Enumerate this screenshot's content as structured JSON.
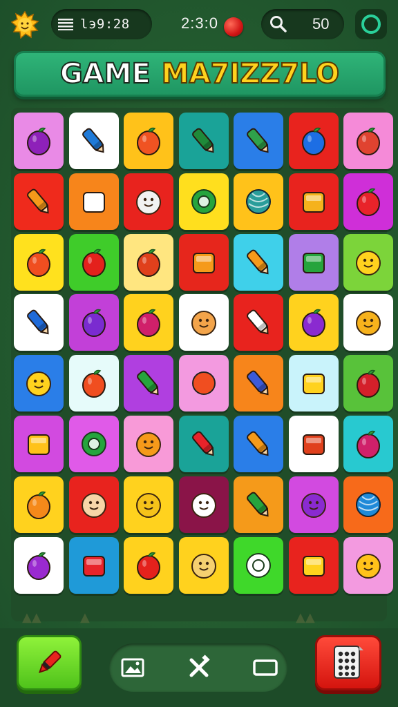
{
  "top_bar": {
    "menu_label": "lэ9:28",
    "timer": "2:3:0",
    "score": "50"
  },
  "banner": {
    "title_white": "GAME",
    "title_yellow": "MA7IZZ7LO"
  },
  "tiles": [
    {
      "bg": "#e98ae6",
      "icon": "plum-icon",
      "fg": "#8e21b9"
    },
    {
      "bg": "#ffffff",
      "icon": "bird-icon",
      "fg": "#1f7ad8"
    },
    {
      "bg": "#ffc21a",
      "icon": "tomato-icon",
      "fg": "#f05322"
    },
    {
      "bg": "#1aa398",
      "icon": "marker-icon",
      "fg": "#1f8a3a"
    },
    {
      "bg": "#2a7ee8",
      "icon": "phone-icon",
      "fg": "#2fa14a"
    },
    {
      "bg": "#e8231e",
      "icon": "blueberry-icon",
      "fg": "#1d6ee4"
    },
    {
      "bg": "#f58ad8",
      "icon": "strawberry-icon",
      "fg": "#e04330"
    },
    {
      "bg": "#ef2a1c",
      "icon": "hand-icon",
      "fg": "#f59a1a"
    },
    {
      "bg": "#f7851b",
      "icon": "cup-icon",
      "fg": "#ffffff"
    },
    {
      "bg": "#e8231e",
      "icon": "cat-face-icon",
      "fg": "#f2f2f2"
    },
    {
      "bg": "#ffdf1e",
      "icon": "target-icon",
      "fg": "#26a43d"
    },
    {
      "bg": "#ffc21a",
      "icon": "yarn-ball-icon",
      "fg": "#2a9d9a"
    },
    {
      "bg": "#e8231e",
      "icon": "battery-icon",
      "fg": "#f5b21c"
    },
    {
      "bg": "#cf2fd8",
      "icon": "apple-icon",
      "fg": "#e8232a"
    },
    {
      "bg": "#ffe11e",
      "icon": "orange-icon",
      "fg": "#f04e20"
    },
    {
      "bg": "#3fcc2a",
      "icon": "apple-icon",
      "fg": "#e4211c"
    },
    {
      "bg": "#ffe680",
      "icon": "peach-icon",
      "fg": "#e0401c"
    },
    {
      "bg": "#e6261c",
      "icon": "notepad-icon",
      "fg": "#f59a1a"
    },
    {
      "bg": "#3fd0ea",
      "icon": "flashlight-icon",
      "fg": "#f59a1a"
    },
    {
      "bg": "#b07ee8",
      "icon": "cube-icon",
      "fg": "#26a43d"
    },
    {
      "bg": "#7cd43a",
      "icon": "lemon-face-icon",
      "fg": "#ffd21e"
    },
    {
      "bg": "#ffffff",
      "icon": "tooth-icon",
      "fg": "#1f6ad8"
    },
    {
      "bg": "#c240d8",
      "icon": "grapes-icon",
      "fg": "#7a2bd0"
    },
    {
      "bg": "#ffd21e",
      "icon": "beet-icon",
      "fg": "#d0206a"
    },
    {
      "bg": "#ffffff",
      "icon": "lion-face-icon",
      "fg": "#f3a44a"
    },
    {
      "bg": "#e8231e",
      "icon": "ice-cream-icon",
      "fg": "#ffffff"
    },
    {
      "bg": "#ffd21e",
      "icon": "raspberry-icon",
      "fg": "#8a2ad0"
    },
    {
      "bg": "#ffffff",
      "icon": "sun-face-icon",
      "fg": "#f7b21c"
    },
    {
      "bg": "#2a7ee8",
      "icon": "star-face-icon",
      "fg": "#ffd21e"
    },
    {
      "bg": "#e6fbfa",
      "icon": "orange-icon",
      "fg": "#f04e20"
    },
    {
      "bg": "#b03fe0",
      "icon": "leaf-icon",
      "fg": "#26a43d"
    },
    {
      "bg": "#f39ae0",
      "icon": "sunflower-icon",
      "fg": "#f04e20"
    },
    {
      "bg": "#f7851b",
      "icon": "roll-icon",
      "fg": "#3c5ad8"
    },
    {
      "bg": "#c9f3fb",
      "icon": "cheese-icon",
      "fg": "#ffd21e"
    },
    {
      "bg": "#58c23a",
      "icon": "strawberry-icon",
      "fg": "#d4202a"
    },
    {
      "bg": "#d24ae0",
      "icon": "lock-icon",
      "fg": "#ffc21a"
    },
    {
      "bg": "#e05ae8",
      "icon": "ring-icon",
      "fg": "#26a43d"
    },
    {
      "bg": "#f89ad8",
      "icon": "sun-face-icon",
      "fg": "#f59a1a"
    },
    {
      "bg": "#1aa398",
      "icon": "lipstick-icon",
      "fg": "#e8232a"
    },
    {
      "bg": "#2a7ee8",
      "icon": "pencil-icon",
      "fg": "#f59a1a"
    },
    {
      "bg": "#ffffff",
      "icon": "box-icon",
      "fg": "#e0401c"
    },
    {
      "bg": "#28c9d0",
      "icon": "peach-icon",
      "fg": "#d0206a"
    },
    {
      "bg": "#ffd21e",
      "icon": "mango-icon",
      "fg": "#f5891a"
    },
    {
      "bg": "#e8231e",
      "icon": "cat-face-icon",
      "fg": "#f7d6a8"
    },
    {
      "bg": "#ffd21e",
      "icon": "sun-face-icon",
      "fg": "#f5c21a"
    },
    {
      "bg": "#8a1448",
      "icon": "dog-face-icon",
      "fg": "#ffffff"
    },
    {
      "bg": "#f59a1a",
      "icon": "whistle-icon",
      "fg": "#26a43d"
    },
    {
      "bg": "#d24ae0",
      "icon": "blob-face-icon",
      "fg": "#8a2ad0"
    },
    {
      "bg": "#f76a1a",
      "icon": "yarn-ball-icon",
      "fg": "#1f8ad8"
    },
    {
      "bg": "#ffffff",
      "icon": "raspberry-icon",
      "fg": "#9a2ad0"
    },
    {
      "bg": "#1f9ad8",
      "icon": "jar-icon",
      "fg": "#e8232a"
    },
    {
      "bg": "#ffd21e",
      "icon": "strawberry-icon",
      "fg": "#e4211c"
    },
    {
      "bg": "#ffd21e",
      "icon": "bear-face-icon",
      "fg": "#f5d070"
    },
    {
      "bg": "#3fd82a",
      "icon": "syringe-icon",
      "fg": "#ffffff"
    },
    {
      "bg": "#e8231e",
      "icon": "castle-icon",
      "fg": "#ffd21e"
    },
    {
      "bg": "#f39ae0",
      "icon": "sun-face-icon",
      "fg": "#ffc21a"
    }
  ],
  "colors": {
    "background": "#1f5a2e",
    "banner": "#2fb478",
    "accent_red": "#e8231e",
    "accent_green": "#4fc21b"
  }
}
